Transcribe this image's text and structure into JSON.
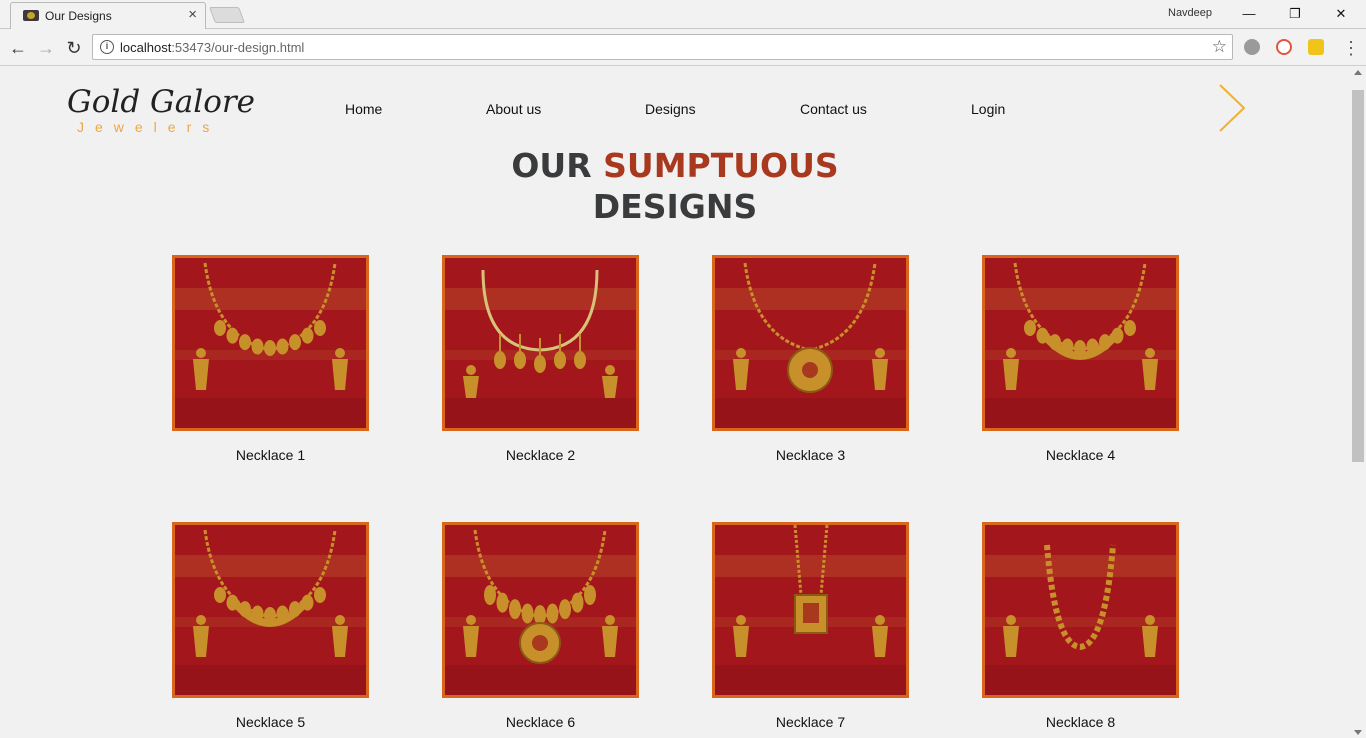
{
  "browser": {
    "tab_title": "Our Designs",
    "tab_close": "×",
    "profile_name": "Navdeep",
    "url_host": "localhost",
    "url_rest": ":53473/our-design.html",
    "window_controls": {
      "minimize": "—",
      "restore": "❐",
      "close": "✕"
    }
  },
  "site": {
    "logo_main": "Gold Galore",
    "logo_sub": "Jewelers",
    "nav": [
      "Home",
      "About us",
      "Designs",
      "Contact us",
      "Login"
    ],
    "heading_part1": "OUR",
    "heading_accent": "SUMPTUOUS",
    "heading_part2": "DESIGNS"
  },
  "designs": [
    {
      "name": "Necklace 1",
      "style": "drops"
    },
    {
      "name": "Necklace 2",
      "style": "hoop"
    },
    {
      "name": "Necklace 3",
      "style": "pendant"
    },
    {
      "name": "Necklace 4",
      "style": "collar"
    },
    {
      "name": "Necklace 5",
      "style": "collar"
    },
    {
      "name": "Necklace 6",
      "style": "bib"
    },
    {
      "name": "Necklace 7",
      "style": "long-pendant"
    },
    {
      "name": "Necklace 8",
      "style": "beads"
    }
  ],
  "colors": {
    "accent": "#a9391e",
    "frame": "#d9661a",
    "logo_sub": "#f0a640",
    "backdrop": "#a3171c",
    "gold": "#c8902a"
  }
}
